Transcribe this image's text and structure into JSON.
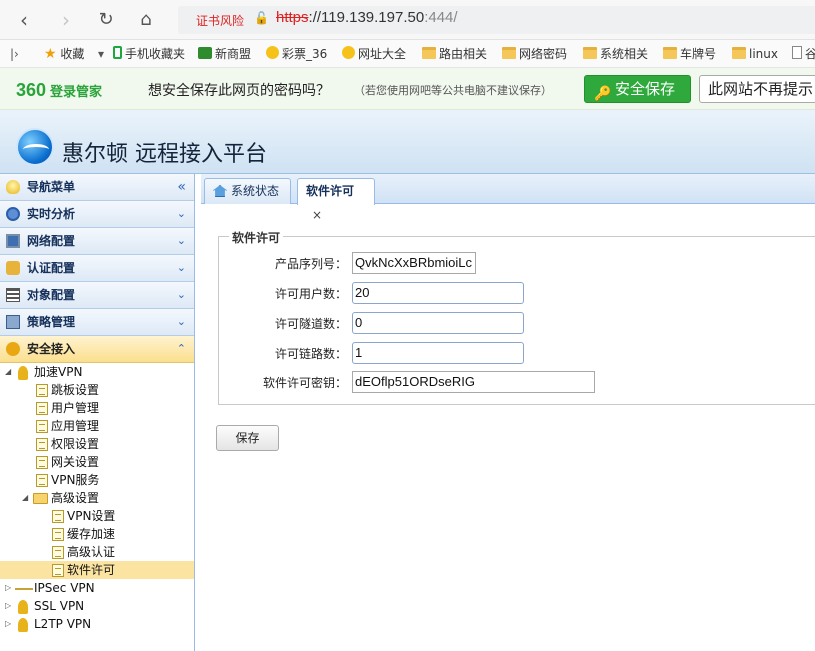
{
  "browser": {
    "cert_warning": "证书风险",
    "url_protocol": "https",
    "url_host": "://119.139.197.50",
    "url_port": ":444/"
  },
  "bookmarks": [
    {
      "label": "收藏",
      "icon": "star-icon"
    },
    {
      "label": "手机收藏夹",
      "icon": "phone-icon"
    },
    {
      "label": "新商盟",
      "icon": "site-icon"
    },
    {
      "label": "彩票_36",
      "icon": "coin-icon"
    },
    {
      "label": "网址大全",
      "icon": "coin-icon"
    },
    {
      "label": "路由相关",
      "icon": "folder-icon"
    },
    {
      "label": "网络密码",
      "icon": "folder-icon"
    },
    {
      "label": "系统相关",
      "icon": "folder-icon"
    },
    {
      "label": "车牌号",
      "icon": "folder-icon"
    },
    {
      "label": "linux",
      "icon": "folder-icon"
    },
    {
      "label": "谷",
      "icon": "page-icon"
    }
  ],
  "password_bar": {
    "brand": "360",
    "brand_suffix": "登录管家",
    "question": "想安全保存此网页的密码吗？",
    "note": "（若您使用网吧等公共电脑不建议保存）",
    "save_button": "安全保存",
    "never_button": "此网站不再提示"
  },
  "app": {
    "title": "惠尔顿 远程接入平台"
  },
  "sidebar": {
    "sections": [
      {
        "label": "导航菜单",
        "icon": "bulb-icon",
        "chevron": "«"
      },
      {
        "label": "实时分析",
        "icon": "clock-icon",
        "chevron": "⌄"
      },
      {
        "label": "网络配置",
        "icon": "monitor-icon",
        "chevron": "⌄"
      },
      {
        "label": "认证配置",
        "icon": "auth-icon",
        "chevron": "⌄"
      },
      {
        "label": "对象配置",
        "icon": "list-icon",
        "chevron": "⌄"
      },
      {
        "label": "策略管理",
        "icon": "policy-icon",
        "chevron": "⌄"
      },
      {
        "label": "安全接入",
        "icon": "key-icon",
        "chevron": "⌃"
      }
    ],
    "tree": [
      {
        "label": "加速VPN",
        "level": 0,
        "icon": "key-icon",
        "expanded": true
      },
      {
        "label": "跳板设置",
        "level": 1,
        "icon": "doc-icon"
      },
      {
        "label": "用户管理",
        "level": 1,
        "icon": "doc-icon"
      },
      {
        "label": "应用管理",
        "level": 1,
        "icon": "doc-icon"
      },
      {
        "label": "权限设置",
        "level": 1,
        "icon": "doc-icon"
      },
      {
        "label": "网关设置",
        "level": 1,
        "icon": "doc-icon"
      },
      {
        "label": "VPN服务",
        "level": 1,
        "icon": "doc-icon"
      },
      {
        "label": "高级设置",
        "level": 1,
        "icon": "folder-icon",
        "expanded": true
      },
      {
        "label": "VPN设置",
        "level": 2,
        "icon": "doc-icon"
      },
      {
        "label": "缓存加速",
        "level": 2,
        "icon": "doc-icon"
      },
      {
        "label": "高级认证",
        "level": 2,
        "icon": "doc-icon"
      },
      {
        "label": "软件许可",
        "level": 2,
        "icon": "doc-icon",
        "selected": true
      },
      {
        "label": "IPSec VPN",
        "level": 0,
        "icon": "ipsec-icon",
        "expanded": false
      },
      {
        "label": "SSL VPN",
        "level": 0,
        "icon": "key-icon",
        "expanded": false
      },
      {
        "label": "L2TP VPN",
        "level": 0,
        "icon": "key-icon",
        "expanded": false
      }
    ]
  },
  "tabs": [
    {
      "label": "系统状态",
      "icon": "home-icon"
    },
    {
      "label": "软件许可",
      "close": "×"
    }
  ],
  "form": {
    "legend": "软件许可",
    "fields": [
      {
        "label": "产品序列号：",
        "value": "QvkNcXxBRbmioiLc"
      },
      {
        "label": "许可用户数：",
        "value": "20"
      },
      {
        "label": "许可隧道数：",
        "value": "0"
      },
      {
        "label": "许可链路数：",
        "value": "1"
      },
      {
        "label": "软件许可密钥：",
        "value": "dEOflp51ORDseRIG"
      }
    ],
    "save_button": "保存"
  }
}
